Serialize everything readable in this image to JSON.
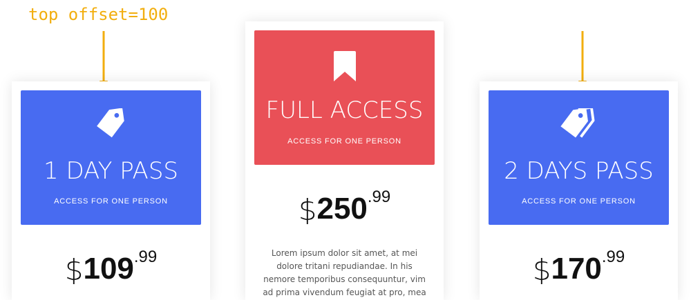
{
  "annotation": {
    "text": "top offset=100",
    "color": "#F2AE0E"
  },
  "colors": {
    "blue": "#486BF1",
    "red": "#E95057",
    "white": "#FFFFFF",
    "price_text": "#111111"
  },
  "cards": [
    {
      "icon": "tag-icon",
      "title": "1 DAY PASS",
      "subtitle": "ACCESS FOR ONE PERSON",
      "price": {
        "currency": "$",
        "main": "109",
        "cents": ".99"
      }
    },
    {
      "icon": "bookmark-icon",
      "title": "FULL ACCESS",
      "subtitle": "ACCESS FOR ONE PERSON",
      "price": {
        "currency": "$",
        "main": "250",
        "cents": ".99"
      },
      "description": "Lorem ipsum dolor sit amet, at mei dolore tritani repudiandae. In his nemore temporibus consequuntur, vim ad prima vivendum  feugiat at pro, mea aperiam."
    },
    {
      "icon": "tags-icon",
      "title": "2 DAYS PASS",
      "subtitle": "ACCESS FOR ONE PERSON",
      "price": {
        "currency": "$",
        "main": "170",
        "cents": ".99"
      }
    }
  ]
}
